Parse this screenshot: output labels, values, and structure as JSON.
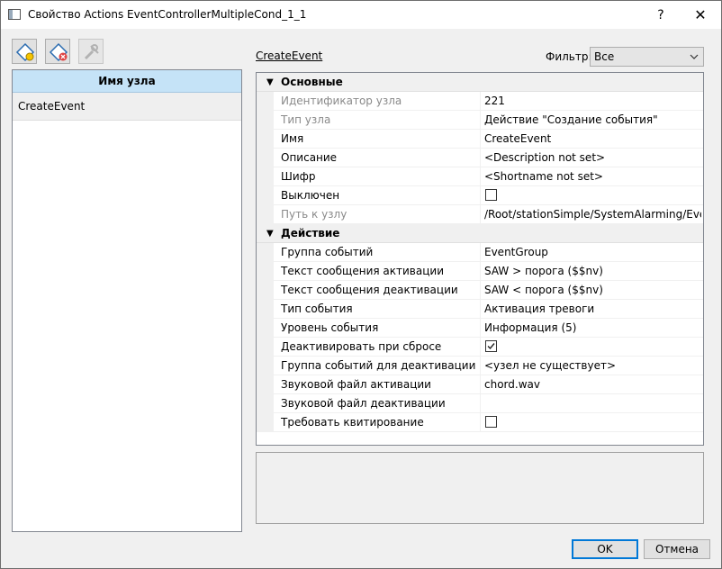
{
  "window": {
    "title": "Свойство Actions EventControllerMultipleCond_1_1",
    "help_glyph": "?",
    "close_glyph": "✕"
  },
  "toolbar": {
    "icons": [
      "add-node-icon",
      "delete-node-icon",
      "tools-icon"
    ]
  },
  "left_panel": {
    "header": "Имя узла",
    "items": [
      {
        "label": "CreateEvent"
      }
    ]
  },
  "property_header": {
    "link": "CreateEvent",
    "filter_label": "Фильтр:",
    "filter_value": "Все"
  },
  "properties": {
    "sections": [
      {
        "title": "Основные",
        "rows": [
          {
            "name": "Идентификатор узла",
            "value": "221",
            "readonly": true
          },
          {
            "name": "Тип узла",
            "value": "Действие \"Создание события\"",
            "readonly": true
          },
          {
            "name": "Имя",
            "value": "CreateEvent"
          },
          {
            "name": "Описание",
            "value": "<Description not set>"
          },
          {
            "name": "Шифр",
            "value": "<Shortname not set>"
          },
          {
            "name": "Выключен",
            "checkbox": true,
            "checked": false
          },
          {
            "name": "Путь к узлу",
            "value": "/Root/stationSimple/SystemAlarming/Event...",
            "readonly": true
          }
        ]
      },
      {
        "title": "Действие",
        "rows": [
          {
            "name": "Группа событий",
            "value": "EventGroup"
          },
          {
            "name": "Текст сообщения активации",
            "value": "SAW > порога ($$nv)"
          },
          {
            "name": "Текст сообщения деактивации",
            "value": "SAW < порога ($$nv)"
          },
          {
            "name": "Тип события",
            "value": "Активация тревоги"
          },
          {
            "name": "Уровень события",
            "value": "Информация (5)"
          },
          {
            "name": "Деактивировать при сбросе",
            "checkbox": true,
            "checked": true
          },
          {
            "name": "Группа событий для деактивации",
            "value": "<узел не существует>"
          },
          {
            "name": "Звуковой файл активации",
            "value": "chord.wav"
          },
          {
            "name": "Звуковой файл деактивации",
            "value": ""
          },
          {
            "name": "Требовать квитирование",
            "checkbox": true,
            "checked": false
          }
        ]
      }
    ]
  },
  "buttons": {
    "ok": "OK",
    "cancel": "Отмена"
  },
  "colors": {
    "accent": "#0078d7",
    "header_bg": "#c5e3f7"
  }
}
